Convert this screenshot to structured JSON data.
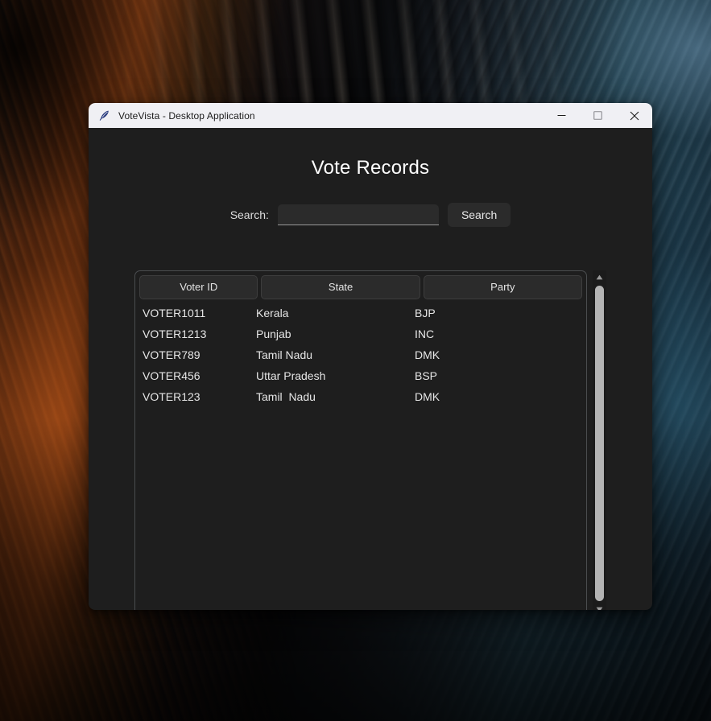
{
  "window": {
    "title": "VoteVista - Desktop Application",
    "icon": "feather-icon",
    "controls": {
      "minimize": "minimize-icon",
      "maximize": "maximize-icon",
      "close": "close-icon"
    }
  },
  "page": {
    "title": "Vote Records"
  },
  "search": {
    "label": "Search:",
    "value": "",
    "placeholder": "",
    "button_label": "Search"
  },
  "table": {
    "columns": [
      "Voter ID",
      "State",
      "Party"
    ],
    "rows": [
      {
        "voter_id": "VOTER1011",
        "state": "Kerala",
        "party": "BJP"
      },
      {
        "voter_id": "VOTER1213",
        "state": "Punjab",
        "party": "INC"
      },
      {
        "voter_id": "VOTER789",
        "state": "Tamil Nadu",
        "party": "DMK"
      },
      {
        "voter_id": "VOTER456",
        "state": "Uttar Pradesh",
        "party": "BSP"
      },
      {
        "voter_id": "VOTER123",
        "state": "Tamil  Nadu",
        "party": "DMK"
      }
    ]
  },
  "scrollbar": {
    "up_arrow": "triangle-up-icon",
    "down_arrow": "triangle-down-icon"
  },
  "colors": {
    "app_background": "#1e1e1e",
    "titlebar_background": "#f0f0f4",
    "control_surface": "#2b2b2b",
    "text_primary": "#e6e6e6",
    "border": "#4a4d4f",
    "scrollbar_thumb": "#b4b4b4"
  }
}
